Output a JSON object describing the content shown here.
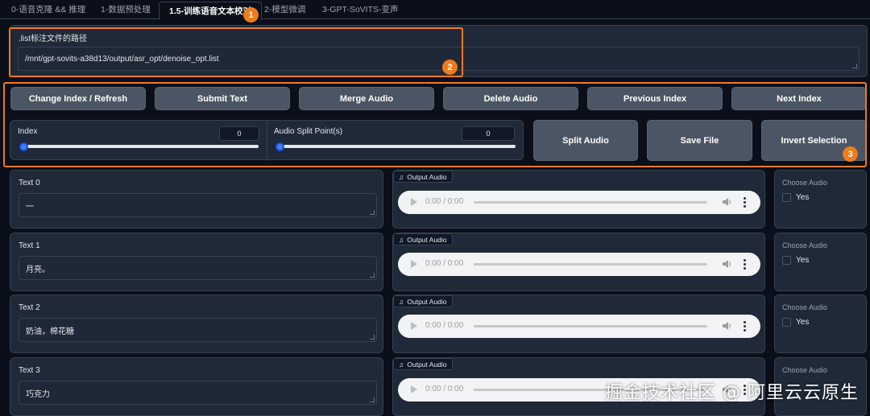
{
  "tabs": [
    {
      "label": "0-语音克隆 && 推理"
    },
    {
      "label": "1-数据预处理"
    },
    {
      "label": "1.5-训练语音文本校对"
    },
    {
      "label": "2-模型微调"
    },
    {
      "label": "3-GPT-SoVITS-变声"
    }
  ],
  "list_path": {
    "label": ".list标注文件的路径",
    "value": "/mnt/gpt-sovits-a38d13/output/asr_opt/denoise_opt.list"
  },
  "actions": {
    "change_index": "Change Index / Refresh",
    "submit_text": "Submit Text",
    "merge_audio": "Merge Audio",
    "delete_audio": "Delete Audio",
    "previous_index": "Previous Index",
    "next_index": "Next Index",
    "split_audio": "Split Audio",
    "save_file": "Save File",
    "invert_selection": "Invert Selection"
  },
  "sliders": {
    "index": {
      "label": "Index",
      "value": "0",
      "level": 0
    },
    "split": {
      "label": "Audio Split Point(s)",
      "value": "0",
      "level": 0
    }
  },
  "rows": [
    {
      "text_label": "Text 0",
      "text_value": "一",
      "audio_label": "Output Audio",
      "time": "0:00 / 0:00",
      "choose_label": "Choose Audio",
      "option": "Yes"
    },
    {
      "text_label": "Text 1",
      "text_value": "月亮。",
      "audio_label": "Output Audio",
      "time": "0:00 / 0:00",
      "choose_label": "Choose Audio",
      "option": "Yes"
    },
    {
      "text_label": "Text 2",
      "text_value": "奶油，棉花糖",
      "audio_label": "Output Audio",
      "time": "0:00 / 0:00",
      "choose_label": "Choose Audio",
      "option": "Yes"
    },
    {
      "text_label": "Text 3",
      "text_value": "巧克力",
      "audio_label": "Output Audio",
      "time": "0:00 / 0:00",
      "choose_label": "Choose Audio",
      "option": ""
    }
  ],
  "annotations": [
    "1",
    "2",
    "3"
  ],
  "watermark": "掘金技术社区 @ 阿里云云原生",
  "colors": {
    "accent_orange": "#f07b1c",
    "slider_blue": "#3b82f6",
    "background": "#0b0f19",
    "panel": "#1f2937"
  },
  "icons": [
    "music-note-icon",
    "play-icon",
    "volume-icon",
    "more-vert-icon"
  ]
}
